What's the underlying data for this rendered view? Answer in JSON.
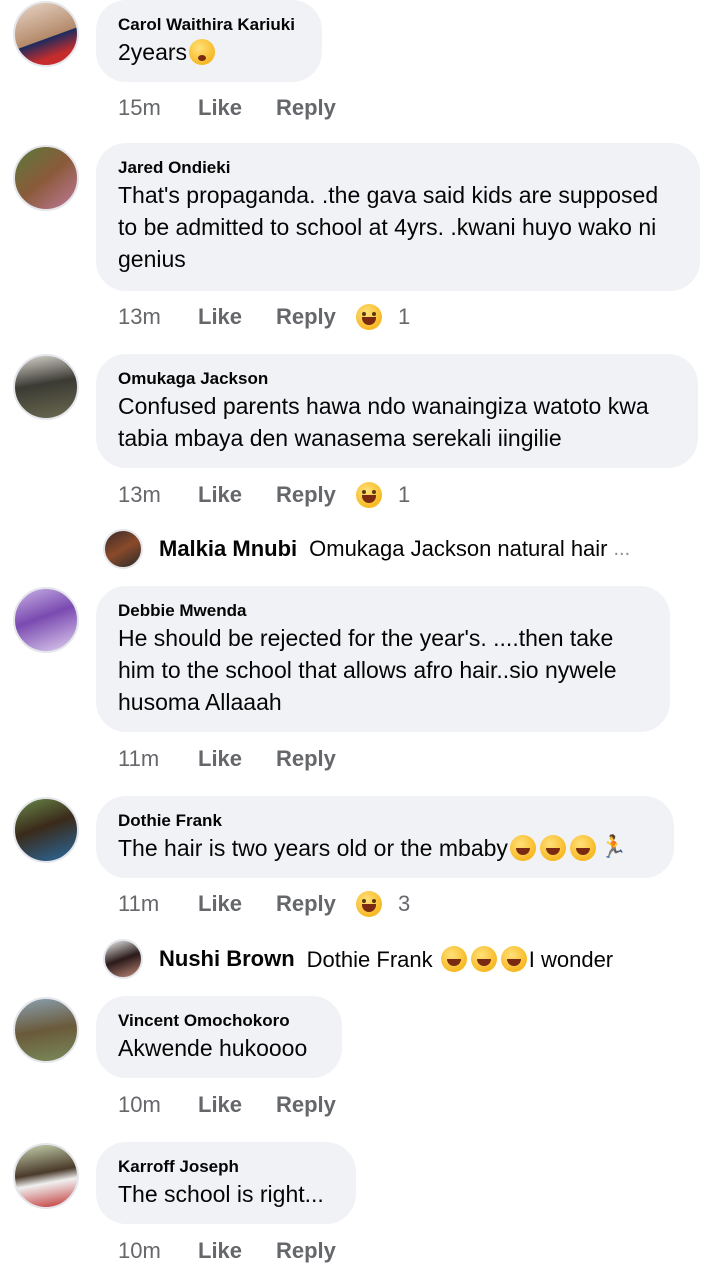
{
  "comments": [
    {
      "author": "Carol Waithira Kariuki",
      "text": "2years",
      "time": "15m",
      "like": "Like",
      "reply": "Reply",
      "reaction_count": ""
    },
    {
      "author": "Jared Ondieki",
      "text": "That's propaganda. .the gava said kids are supposed to be admitted to school at 4yrs. .kwani huyo wako ni genius",
      "time": "13m",
      "like": "Like",
      "reply": "Reply",
      "reaction_count": "1"
    },
    {
      "author": "Omukaga Jackson",
      "text": "Confused parents hawa ndo wanaingiza watoto kwa tabia mbaya den wanasema serekali iingilie",
      "time": "13m",
      "like": "Like",
      "reply": "Reply",
      "reaction_count": "1"
    },
    {
      "author": "Debbie Mwenda",
      "text": "He should be rejected for the year's.  ....then take him to the school that allows afro hair..sio nywele husoma Allaaah",
      "time": "11m",
      "like": "Like",
      "reply": "Reply",
      "reaction_count": ""
    },
    {
      "author": "Dothie Frank",
      "text": "The hair is two years old or the mbaby",
      "time": "11m",
      "like": "Like",
      "reply": "Reply",
      "reaction_count": "3"
    },
    {
      "author": "Vincent Omochokoro",
      "text": "Akwende hukoooo",
      "time": "10m",
      "like": "Like",
      "reply": "Reply",
      "reaction_count": ""
    },
    {
      "author": "Karroff Joseph",
      "text": "The school is right...",
      "time": "10m",
      "like": "Like",
      "reply": "Reply",
      "reaction_count": ""
    }
  ],
  "replies": [
    {
      "author": "Malkia Mnubi",
      "text": "Omukaga Jackson  natural hair",
      "ellipsis": "..."
    },
    {
      "author": "Nushi Brown",
      "text_before": "Dothie Frank",
      "text_after": "I wonder"
    }
  ],
  "colors": {
    "bubble": "#f0f2f5",
    "meta": "#65676b",
    "text": "#050505"
  }
}
